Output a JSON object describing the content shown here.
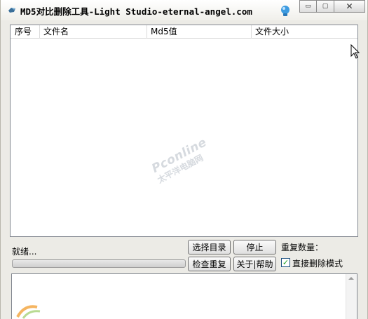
{
  "window": {
    "title": "MD5对比删除工具-Light Studio-eternal-angel.com",
    "controls": {
      "minimize": "▭",
      "maximize": "▢",
      "close": "✕"
    }
  },
  "listview": {
    "columns": [
      "序号",
      "文件名",
      "Md5值",
      "文件大小"
    ],
    "rows": []
  },
  "watermark": {
    "brand": "Pconline",
    "sub": "太平洋电脑网"
  },
  "status": {
    "text": "就绪...",
    "progress": 0
  },
  "buttons": {
    "select_dir": "选择目录",
    "stop": "停止",
    "check_dup": "检查重复",
    "about_help": "关于|帮助"
  },
  "dup_count_label": "重复数量：",
  "direct_delete": {
    "label": "直接删除模式",
    "checked": true
  },
  "icons": [
    "app-icon",
    "pin-icon",
    "minimize-icon",
    "maximize-icon",
    "close-icon",
    "scroll-up-icon",
    "mouse-cursor-icon"
  ],
  "colors": {
    "accent": "#21a121",
    "window_bg": "#ecebe6"
  }
}
